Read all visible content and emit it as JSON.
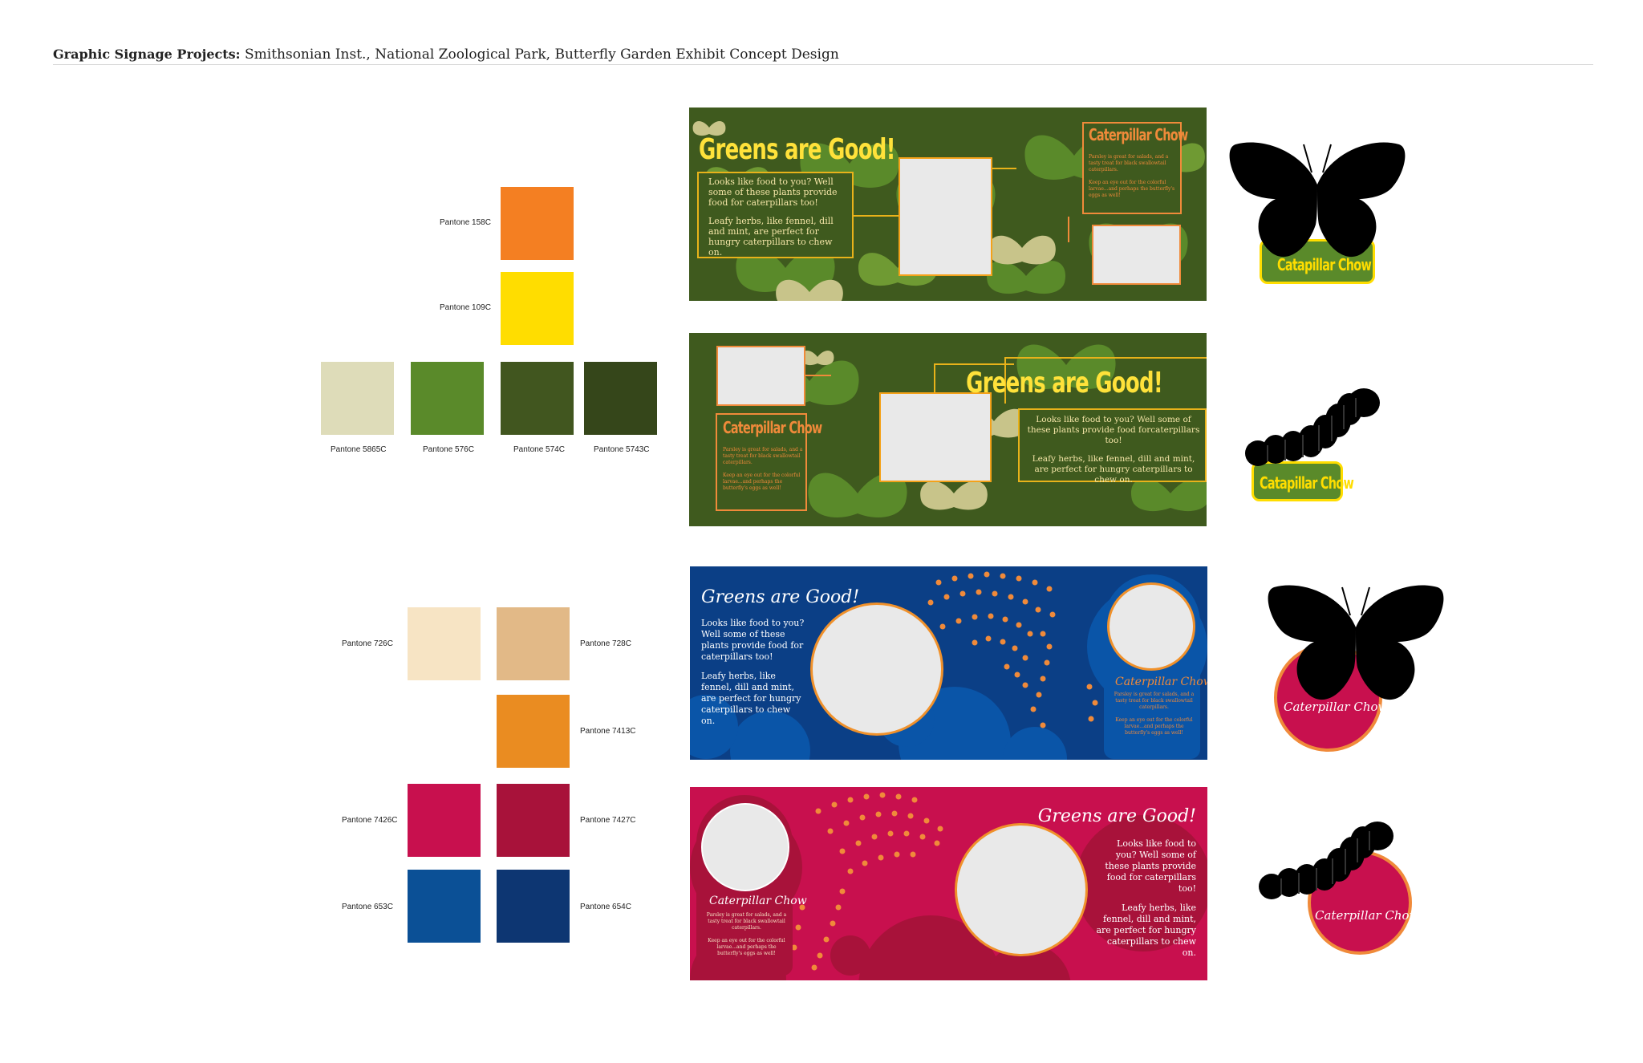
{
  "header": {
    "bold": "Graphic Signage Projects:",
    "rest": "Smithsonian Inst., National Zoological Park, Butterfly Garden Exhibit Concept Design"
  },
  "palette_green": {
    "p158": {
      "label": "Pantone 158C",
      "color": "#f47f22"
    },
    "p109": {
      "label": "Pantone 109C",
      "color": "#ffdd00"
    },
    "p5865": {
      "label": "Pantone 5865C",
      "color": "#dedcb9"
    },
    "p576": {
      "label": "Pantone 576C",
      "color": "#5a8a2a"
    },
    "p574": {
      "label": "Pantone 574C",
      "color": "#41561f"
    },
    "p5743": {
      "label": "Pantone 5743C",
      "color": "#35461a"
    }
  },
  "palette_warm": {
    "p726": {
      "label": "Pantone 726C",
      "color": "#f7e4c4"
    },
    "p728": {
      "label": "Pantone 728C",
      "color": "#e2b987"
    },
    "p7413": {
      "label": "Pantone 7413C",
      "color": "#ea8c21"
    },
    "p7426": {
      "label": "Pantone 7426C",
      "color": "#c8104e"
    },
    "p7427": {
      "label": "Pantone 7427C",
      "color": "#a8123a"
    },
    "p653": {
      "label": "Pantone 653C",
      "color": "#0b5096"
    },
    "p654": {
      "label": "Pantone 654C",
      "color": "#0d3672"
    }
  },
  "panel1": {
    "title": "Greens are Good!",
    "text1": "Looks like food to you? Well some of these plants provide food for caterpillars too!",
    "text2": "Leafy herbs, like fennel, dill and mint, are perfect for hungry caterpillars to chew on.",
    "side_title": "Caterpillar Chow",
    "side_text1": "Parsley is great for salads, and a tasty treat for black swallowtail caterpillars.",
    "side_text2": "Keep an eye out for the colorful larvae...and perhaps the butterfly's eggs as well!"
  },
  "panel2": {
    "title": "Greens are Good!",
    "text1": "Looks like food to you? Well some of these plants provide food forcaterpillars too!",
    "text2": "Leafy herbs, like fennel, dill and mint, are perfect for hungry caterpillars to chew on.",
    "side_title": "Caterpillar Chow",
    "side_text1": "Parsley is great for salads, and a tasty treat for black swallowtail caterpillars.",
    "side_text2": "Keep an eye out for the colorful larvae...and perhaps the butterfly's eggs as well!"
  },
  "panel3": {
    "title": "Greens are Good!",
    "text1": "Looks like food to you? Well some of these plants provide food for caterpillars too!",
    "text2": "Leafy herbs, like fennel, dill and mint, are perfect for hungry caterpillars to chew on.",
    "side_title": "Caterpillar Chow",
    "side_text1": "Parsley is great for salads, and a tasty treat for black swallowtail caterpillars.",
    "side_text2": "Keep an eye out for the colorful larvae...and perhaps the butterfly's eggs as well!"
  },
  "panel4": {
    "title": "Greens are Good!",
    "text1": "Looks like food to you? Well some of these plants provide food for caterpillars too!",
    "text2": "Leafy herbs, like fennel, dill and mint, are perfect for hungry caterpillars to chew on.",
    "side_title": "Caterpillar Chow",
    "side_text1": "Parsley is great for salads, and a tasty treat for black swallowtail caterpillars.",
    "side_text2": "Keep an eye out for the colorful larvae...and perhaps the butterfly's eggs as well!"
  },
  "icons": {
    "icon1_label": "Catapillar Chow",
    "icon2_label": "Catapillar Chow",
    "icon3_label": "Caterpillar Chow",
    "icon4_label": "Caterpillar Chow"
  }
}
